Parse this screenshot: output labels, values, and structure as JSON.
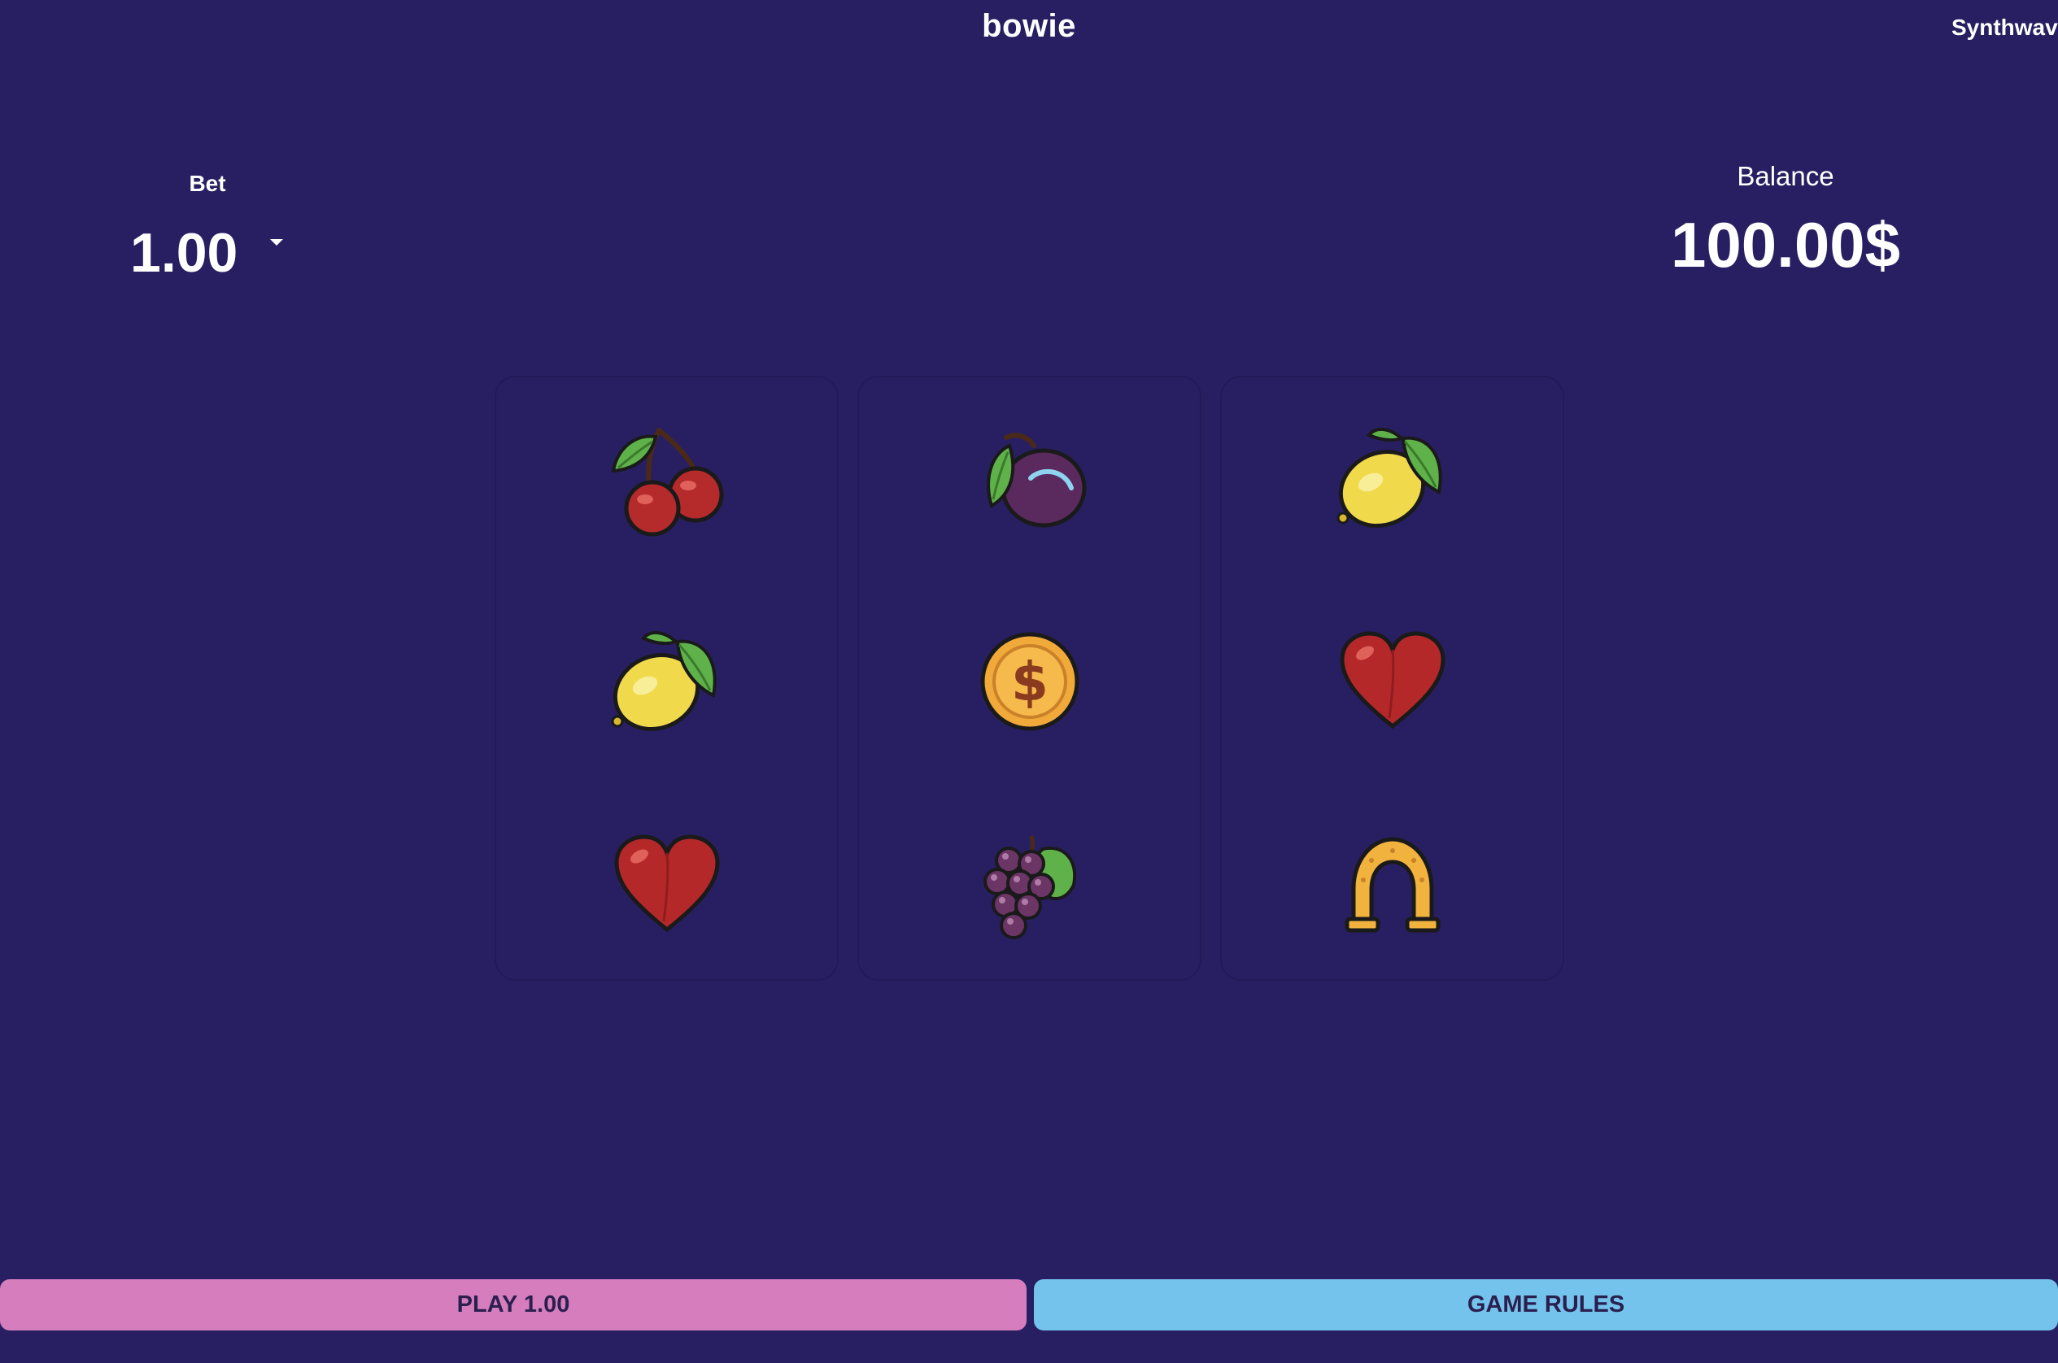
{
  "header": {
    "title": "bowie",
    "theme_label": "Synthwav"
  },
  "bet": {
    "label": "Bet",
    "value": "1.00"
  },
  "balance": {
    "label": "Balance",
    "value": "100.00$"
  },
  "reels": [
    {
      "symbols": [
        "cherry-icon",
        "lemon-icon",
        "heart-icon"
      ]
    },
    {
      "symbols": [
        "plum-icon",
        "coin-icon",
        "grapes-icon"
      ]
    },
    {
      "symbols": [
        "lemon-icon",
        "heart-icon",
        "horseshoe-icon"
      ]
    }
  ],
  "actions": {
    "play_label": "PLAY 1.00",
    "rules_label": "GAME RULES"
  },
  "colors": {
    "background": "#271f62",
    "play_button": "#d67dbd",
    "rules_button": "#74c3ec",
    "button_text": "#2a1f4f"
  }
}
